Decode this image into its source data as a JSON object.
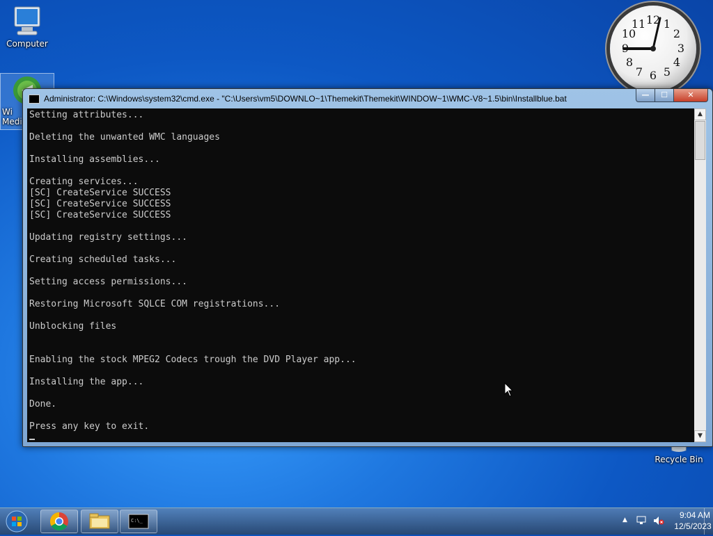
{
  "desktop": {
    "icons": [
      {
        "label": "Computer"
      },
      {
        "label": "Wi\nMedi"
      },
      {
        "label": "Recycle Bin"
      }
    ]
  },
  "gadget": {
    "clock_numbers": [
      "12",
      "1",
      "2",
      "3",
      "4",
      "5",
      "6",
      "7",
      "8",
      "9",
      "10",
      "11"
    ],
    "time": "9:04"
  },
  "window": {
    "title": "Administrator: C:\\Windows\\system32\\cmd.exe - \"C:\\Users\\vm5\\DOWNLO~1\\Themekit\\Themekit\\WINDOW~1\\WMC-V8~1.5\\bin\\Installblue.bat",
    "min_label": "—",
    "max_label": "☐",
    "close_label": "✕",
    "console_lines": [
      "Setting attributes...",
      "",
      "Deleting the unwanted WMC languages",
      "",
      "Installing assemblies...",
      "",
      "Creating services...",
      "[SC] CreateService SUCCESS",
      "[SC] CreateService SUCCESS",
      "[SC] CreateService SUCCESS",
      "",
      "Updating registry settings...",
      "",
      "Creating scheduled tasks...",
      "",
      "Setting access permissions...",
      "",
      "Restoring Microsoft SQLCE COM registrations...",
      "",
      "Unblocking files",
      "",
      "",
      "Enabling the stock MPEG2 Codecs trough the DVD Player app...",
      "",
      "Installing the app...",
      "",
      "Done.",
      "",
      "Press any key to exit."
    ]
  },
  "taskbar": {
    "apps": [
      "start-orb",
      "chrome-icon",
      "explorer-icon",
      "cmd-icon"
    ],
    "tray": {
      "time": "9:04 AM",
      "date": "12/5/2023"
    }
  },
  "colors": {
    "console_bg": "#0c0c0c",
    "console_fg": "#cccccc",
    "desktop": "#1f78e0"
  }
}
